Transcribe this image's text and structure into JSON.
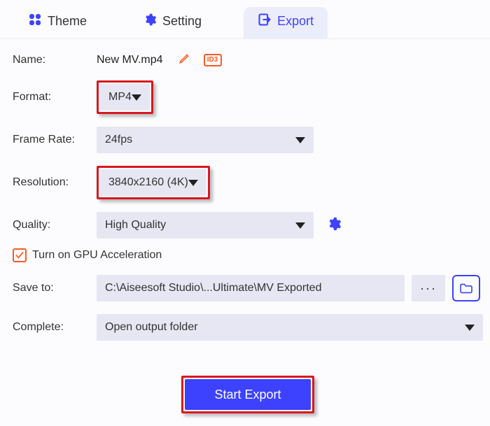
{
  "tabs": {
    "theme": "Theme",
    "setting": "Setting",
    "export": "Export"
  },
  "labels": {
    "name": "Name:",
    "format": "Format:",
    "framerate": "Frame Rate:",
    "resolution": "Resolution:",
    "quality": "Quality:",
    "saveto": "Save to:",
    "complete": "Complete:"
  },
  "values": {
    "filename": "New MV.mp4",
    "format": "MP4",
    "framerate": "24fps",
    "resolution": "3840x2160 (4K)",
    "quality": "High Quality",
    "savepath": "C:\\Aiseesoft Studio\\...Ultimate\\MV Exported",
    "complete": "Open output folder"
  },
  "checkbox": {
    "gpu": "Turn on GPU Acceleration",
    "checked": true
  },
  "buttons": {
    "export": "Start Export",
    "more": "···",
    "id3": "ID3"
  }
}
